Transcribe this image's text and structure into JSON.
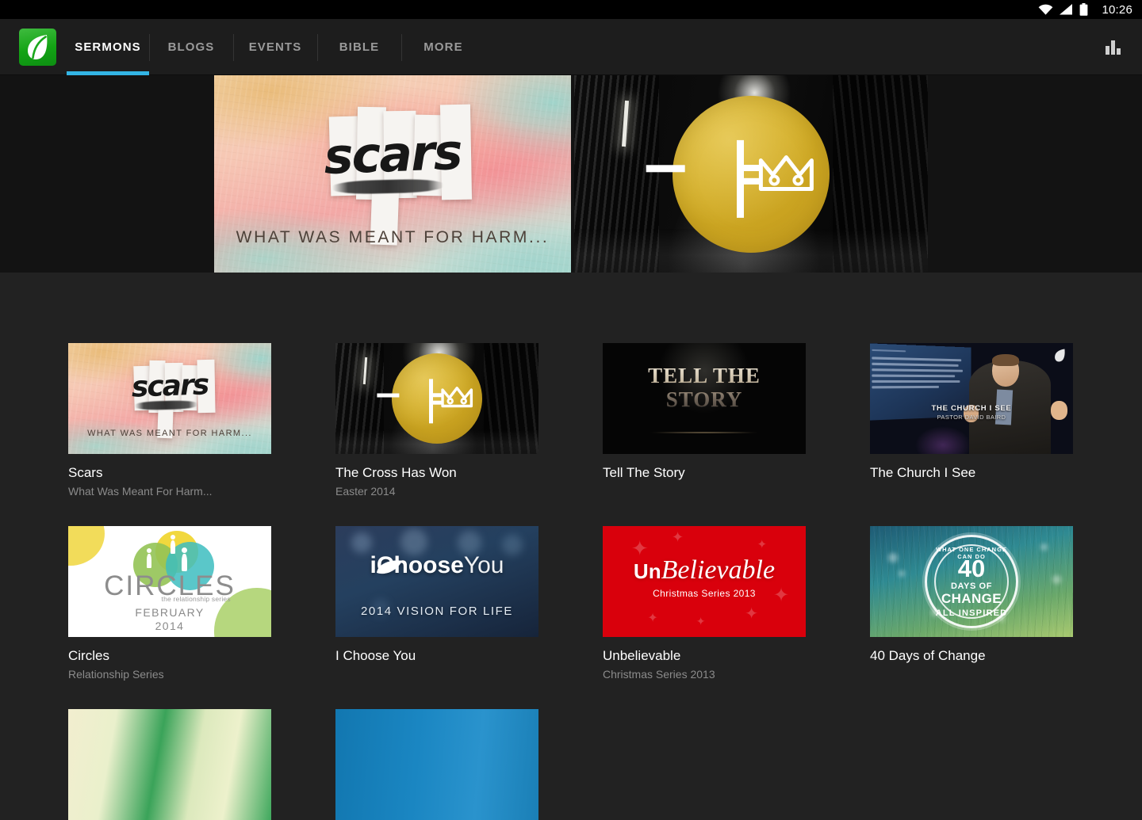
{
  "statusbar": {
    "time": "10:26",
    "icons": [
      "wifi-icon",
      "cellular-signal-icon",
      "battery-icon"
    ]
  },
  "actionbar": {
    "logo_name": "app-logo-leaf",
    "tabs": [
      {
        "label": "SERMONS",
        "active": true
      },
      {
        "label": "BLOGS",
        "active": false
      },
      {
        "label": "EVENTS",
        "active": false
      },
      {
        "label": "BIBLE",
        "active": false
      },
      {
        "label": "MORE",
        "active": false
      }
    ],
    "active_underline_color": "#33b5e5",
    "stats_button": "bar-chart-icon"
  },
  "hero": {
    "items": [
      {
        "name": "Scars",
        "art_word": "scars",
        "art_tagline": "WHAT WAS MEANT FOR HARM..."
      },
      {
        "name": "The Cross Has Won",
        "art_symbol": "cross-equals-crown",
        "circle_color": "#d1ab24"
      }
    ]
  },
  "grid": {
    "cards": [
      {
        "art": "scars",
        "title": "Scars",
        "subtitle": "What Was Meant For Harm...",
        "art_word": "scars",
        "art_tagline": "WHAT WAS MEANT FOR HARM..."
      },
      {
        "art": "cross",
        "title": "The Cross Has Won",
        "subtitle": "Easter 2014"
      },
      {
        "art": "tell",
        "title": "Tell The Story",
        "subtitle": "",
        "art_line1": "TELL THE",
        "art_line2": "STORY"
      },
      {
        "art": "church",
        "title": "The Church I See",
        "subtitle": "",
        "art_caption": "THE CHURCH I SEE",
        "art_caption_sub": "PASTOR DAVID BAIRD"
      },
      {
        "art": "circles",
        "title": "Circles",
        "subtitle": "Relationship Series",
        "art_word": "CIRCLES",
        "art_sub": "the relationship series",
        "art_month": "FEBRUARY",
        "art_year": "2014"
      },
      {
        "art": "ichoose",
        "title": "I Choose You",
        "subtitle": "",
        "art_word_bold": "iChoose",
        "art_word_light": "You",
        "art_sub": "2014 VISION FOR LIFE"
      },
      {
        "art": "unbelievable",
        "title": "Unbelievable",
        "subtitle": "Christmas Series 2013",
        "art_word_un": "Un",
        "art_word_rest": "Believable",
        "art_sub": "Christmas Series 2013"
      },
      {
        "art": "fortydays",
        "title": "40 Days of Change",
        "subtitle": "",
        "badge_top": "WHAT ONE CHANGE CAN DO",
        "badge_num": "40",
        "badge_days": "DAYS OF",
        "badge_change": "CHANGE",
        "badge_bottom": "ALL INSPIRED"
      }
    ],
    "partial_row": [
      {
        "art": "r3a"
      },
      {
        "art": "r3b"
      }
    ]
  },
  "colors": {
    "page_bg": "#222222",
    "hero_band_bg": "#131313",
    "actionbar_bg": "#1d1d1d",
    "statusbar_bg": "#000000",
    "accent": "#33b5e5",
    "logo_green": "#13a314",
    "title_text": "#ffffff",
    "subtitle_text": "#8b8b8b",
    "tab_inactive": "#9a9a9a"
  }
}
